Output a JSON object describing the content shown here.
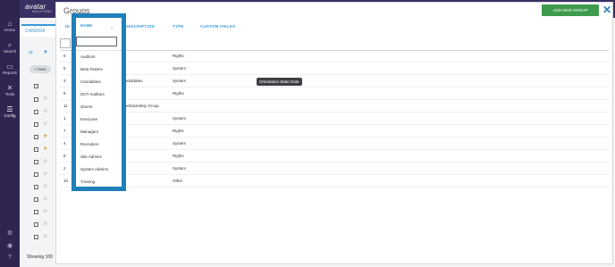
{
  "app": {
    "logo": "avatar",
    "logo_sub": "SOLUTIONS"
  },
  "nav": [
    {
      "label": "Home",
      "icon": "home-icon"
    },
    {
      "label": "Search",
      "icon": "search-icon"
    },
    {
      "label": "Reports",
      "icon": "folder-icon"
    },
    {
      "label": "Tools",
      "icon": "tools-icon"
    },
    {
      "label": "Config",
      "icon": "config-icon"
    }
  ],
  "background": {
    "tab_label": "CANDIDA",
    "new_button": "+ New",
    "showing_label": "Showing",
    "showing_count": "100"
  },
  "modal": {
    "title": "Groups",
    "add_button": "ADD NEW GROUP",
    "columns": {
      "id": "ID",
      "name": "NAME",
      "description": "DESCRIPTION",
      "type": "TYPE",
      "custom_fields": "CUSTOM FIELDS"
    },
    "tooltip": "Orientation State Date",
    "rows": [
      {
        "id": "9",
        "name": "Auditors",
        "description": "",
        "type": "Rights"
      },
      {
        "id": "5",
        "name": "Beta Testers",
        "description": "",
        "type": "System"
      },
      {
        "id": "3",
        "name": "Candidates",
        "description": "andidates",
        "type": "System"
      },
      {
        "id": "8",
        "name": "DOT Auditors",
        "description": "",
        "type": "Rights"
      },
      {
        "id": "11",
        "name": "drivers",
        "description": "ambaSafety Group",
        "type": ""
      },
      {
        "id": "1",
        "name": "Everyone",
        "description": "",
        "type": "System"
      },
      {
        "id": "7",
        "name": "Managers",
        "description": "",
        "type": "Rights"
      },
      {
        "id": "4",
        "name": "Recruiters",
        "description": "",
        "type": "System"
      },
      {
        "id": "6",
        "name": "Site Admins",
        "description": "",
        "type": "Rights"
      },
      {
        "id": "2",
        "name": "System Admins",
        "description": "",
        "type": "System"
      },
      {
        "id": "10",
        "name": "Training",
        "description": "",
        "type": "Other"
      }
    ]
  }
}
